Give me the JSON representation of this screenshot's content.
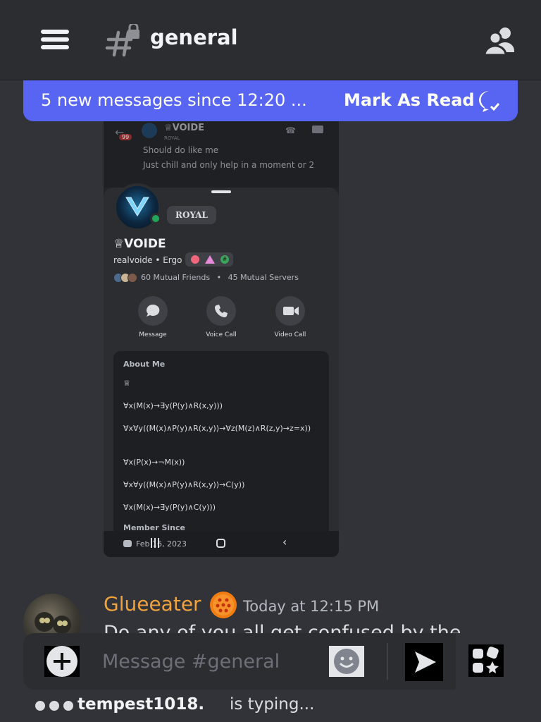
{
  "header": {
    "channel_name": "general",
    "icons": [
      "hamburger-menu-icon",
      "locked-channel-hash-icon",
      "members-icon"
    ]
  },
  "new_messages_bar": {
    "text": "5 new messages since 12:20 ...",
    "mark_as_read": "Mark As Read",
    "icon": "mark-read-chat-icon",
    "color": "#5865f2"
  },
  "embedded_screenshot": {
    "top_preview": {
      "username": "♕VOIDE",
      "role": "ROYAL",
      "unread_badge": "99",
      "line1": "Should do like me",
      "line2": "Just chill and only help in a moment or 2"
    },
    "profile": {
      "banner_tag": "ROYAL",
      "display_name": "♕VOIDE",
      "subtitle": "realvoide • Ergo",
      "mutual_friends": "60 Mutual Friends",
      "mutual_servers": "45 Mutual Servers",
      "mutual_separator": "•",
      "actions": [
        {
          "label": "Message",
          "icon": "message-bubble-icon"
        },
        {
          "label": "Voice Call",
          "icon": "phone-icon"
        },
        {
          "label": "Video Call",
          "icon": "video-camera-icon"
        }
      ],
      "about_me": {
        "heading": "About Me",
        "lines": [
          "♕",
          "∀x(M(x)→∃y(P(y)∧R(x,y)))",
          "∀x∀y((M(x)∧P(y)∧R(x,y))→∀z(M(z)∧R(z,y)→z=x))",
          "∀x(P(x)→¬M(x))",
          "∀x∀y((M(x)∧P(y)∧R(x,y))→C(y))",
          "∀x(M(x)→∃y(P(y)∧C(y)))"
        ],
        "member_since_label": "Member Since",
        "member_since_value": "Feb 16, 2023"
      }
    }
  },
  "message": {
    "author": "Glueeater",
    "author_color": "#f0a23c",
    "timestamp": "Today at 12:15 PM",
    "text_partial": "Do any of you all get confused by the"
  },
  "composer": {
    "placeholder": "Message #general",
    "buttons": [
      "plus-icon",
      "emoji-icon",
      "send-icon",
      "apps-icon"
    ]
  },
  "typing_indicator": {
    "user": "tempest1018.",
    "suffix": "is typing..."
  }
}
